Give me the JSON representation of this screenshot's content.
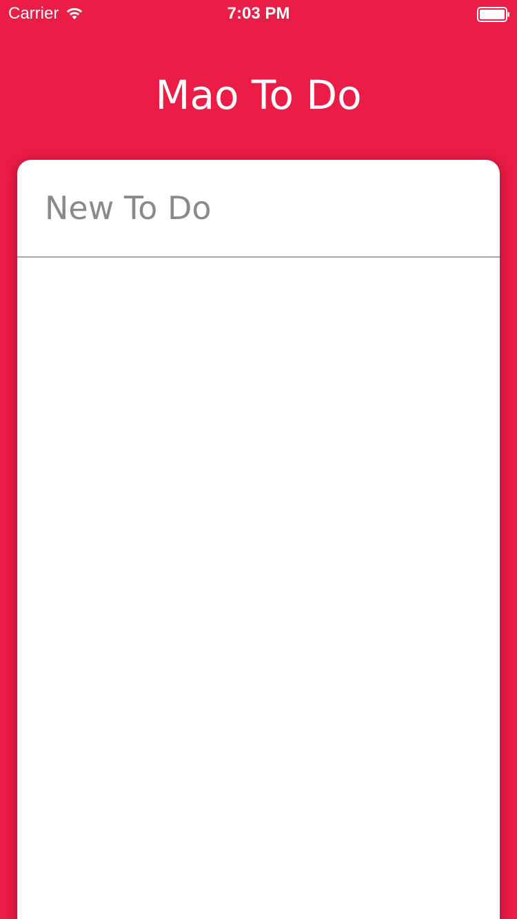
{
  "status_bar": {
    "carrier": "Carrier",
    "time": "7:03 PM",
    "wifi_icon": "wifi-icon",
    "battery_icon": "battery-full-icon"
  },
  "nav": {
    "title": "Mao To Do"
  },
  "new_todo": {
    "placeholder": "New To Do",
    "value": ""
  },
  "todo_list": {
    "items": []
  },
  "colors": {
    "background": "#EB1C46",
    "card": "#FFFFFF",
    "placeholder_text": "#8A8A8A",
    "divider": "#A8A8A8",
    "title_text": "#FFFFFF"
  }
}
